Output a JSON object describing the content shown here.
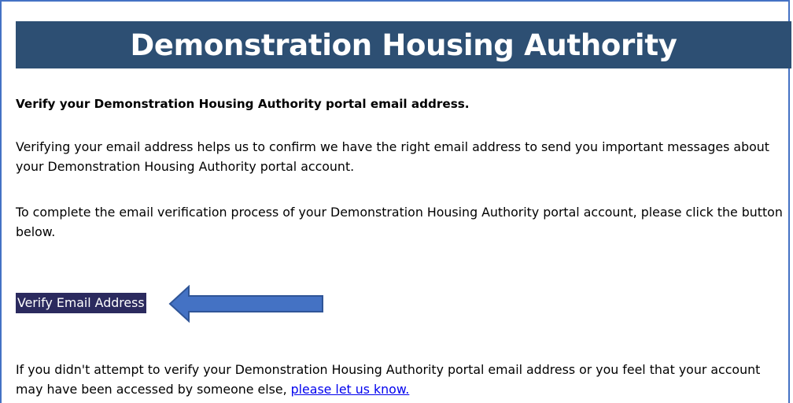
{
  "header": {
    "title": "Demonstration Housing Authority",
    "background_color": "#2d4f73"
  },
  "content": {
    "heading": "Verify your Demonstration Housing Authority portal email address.",
    "paragraph_1": "Verifying your email address helps us to confirm we have the right email address to send you important messages about your Demonstration Housing Authority portal account.",
    "paragraph_2": "To complete the email verification process of your Demonstration Housing Authority portal account, please click the button below.",
    "verify_button_label": "Verify Email Address",
    "paragraph_3_text": "If you didn't attempt to verify your Demonstration Housing Authority portal email address or you feel that your account may have been accessed by someone else, ",
    "paragraph_3_link": "please let us know."
  },
  "annotation": {
    "arrow_icon": "left-arrow-icon",
    "arrow_color": "#4472c4"
  },
  "colors": {
    "frame_border": "#4472c4",
    "button_bg": "#2b2a5e",
    "link": "#0000ee"
  }
}
